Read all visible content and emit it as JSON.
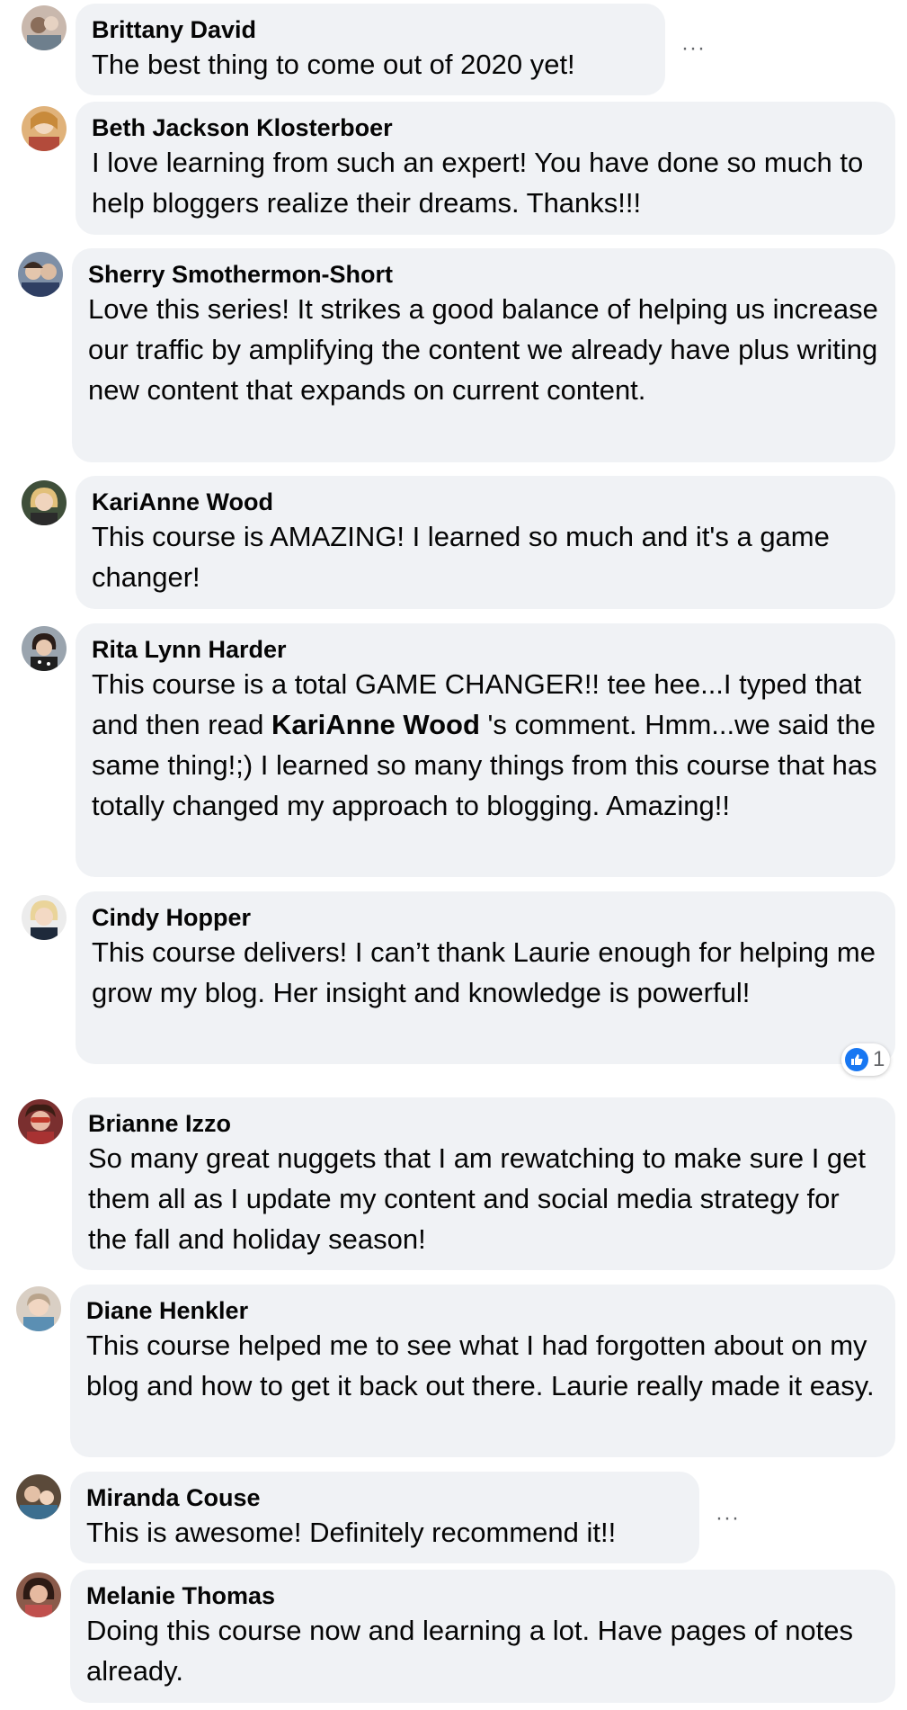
{
  "comments": [
    {
      "author": "Brittany David",
      "text": "The best thing to come out of 2020 yet!",
      "more": "···"
    },
    {
      "author": "Beth Jackson Klosterboer",
      "text": "I love learning from such an expert! You have done so much to help bloggers realize their dreams. Thanks!!!"
    },
    {
      "author": "Sherry Smothermon-Short",
      "text": "Love this series! It strikes a good balance of helping us increase our traffic by amplifying the content we already have plus writing new content that expands on current content."
    },
    {
      "author": "KariAnne Wood",
      "text": "This course is AMAZING! I learned so much and it's a game changer!"
    },
    {
      "author": "Rita Lynn Harder",
      "text_before": "This course is a total GAME CHANGER!! tee hee...I typed that and then read ",
      "mention": "KariAnne Wood",
      "text_after": " 's comment. Hmm...we said the same thing!;) I learned so many things from this course that has totally changed my approach to blogging. Amazing!!"
    },
    {
      "author": "Cindy Hopper",
      "text": "This course delivers! I can’t thank Laurie enough for helping me grow my blog. Her insight and knowledge is powerful!",
      "reaction_count": "1"
    },
    {
      "author": "Brianne Izzo",
      "text": "So many great nuggets that I am rewatching to make sure I get them all as I update my content and social media strategy for the fall and holiday season!"
    },
    {
      "author": "Diane Henkler",
      "text": "This course helped me to see what I had forgotten about on my blog and how to get it back out there. Laurie really made it easy."
    },
    {
      "author": "Miranda Couse",
      "text": "This is awesome! Definitely recommend it!!",
      "more": "···"
    },
    {
      "author": "Melanie Thomas",
      "text": "Doing this course now and learning a lot. Have pages of notes already."
    }
  ],
  "colors": {
    "bubble": "#f0f2f5",
    "text": "#050505",
    "like": "#1877f2"
  },
  "icons": {
    "more": "more-options-icon",
    "reaction": "like-reaction-icon"
  }
}
